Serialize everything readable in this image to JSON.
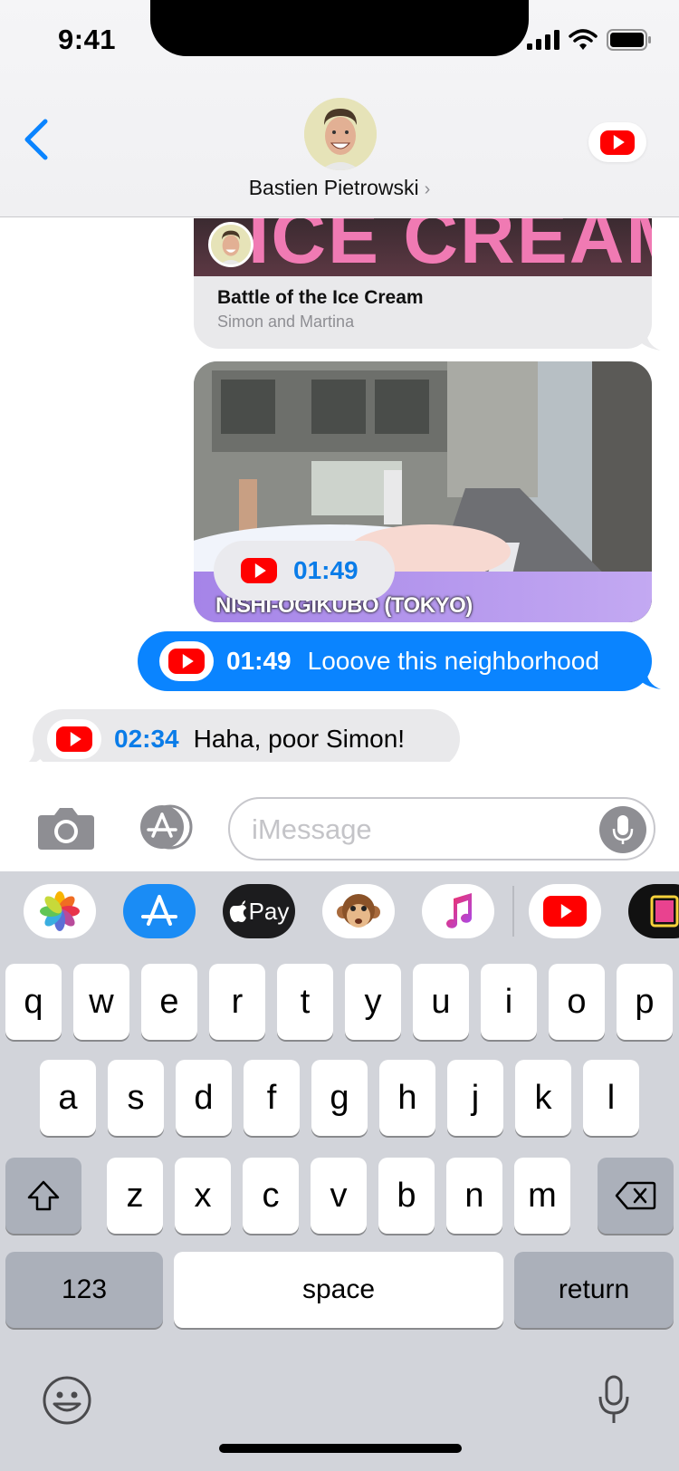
{
  "status_bar": {
    "time": "9:41"
  },
  "header": {
    "contact_name": "Bastien Pietrowski",
    "chevron": "›"
  },
  "messages": {
    "card_link": {
      "thumb_text": "ICE CREAM",
      "title": "Battle of the Ice Cream",
      "subtitle": "Simon and Martina"
    },
    "card_video": {
      "caption": "NISHI-OGIKUBO (TOKYO)",
      "timestamp": "01:49"
    },
    "sent": {
      "timestamp": "01:49",
      "text": "Looove this neighborhood"
    },
    "received": {
      "timestamp": "02:34",
      "text": "Haha, poor Simon!"
    }
  },
  "input": {
    "placeholder": "iMessage",
    "value": ""
  },
  "app_strip": [
    "photos-icon",
    "appstore-icon",
    "apple-pay-icon",
    "animoji-icon",
    "music-icon",
    "youtube-icon",
    "clips-icon"
  ],
  "apple_pay_label": "Pay",
  "keyboard": {
    "row1": [
      "q",
      "w",
      "e",
      "r",
      "t",
      "y",
      "u",
      "i",
      "o",
      "p"
    ],
    "row2": [
      "a",
      "s",
      "d",
      "f",
      "g",
      "h",
      "j",
      "k",
      "l"
    ],
    "row3": [
      "z",
      "x",
      "c",
      "v",
      "b",
      "n",
      "m"
    ],
    "numbers_label": "123",
    "space_label": "space",
    "return_label": "return"
  },
  "colors": {
    "accent": "#0A84FF",
    "youtube_red": "#FF0000",
    "bubble_gray": "#E9E9EB",
    "keyboard_bg": "#D2D4DA"
  }
}
